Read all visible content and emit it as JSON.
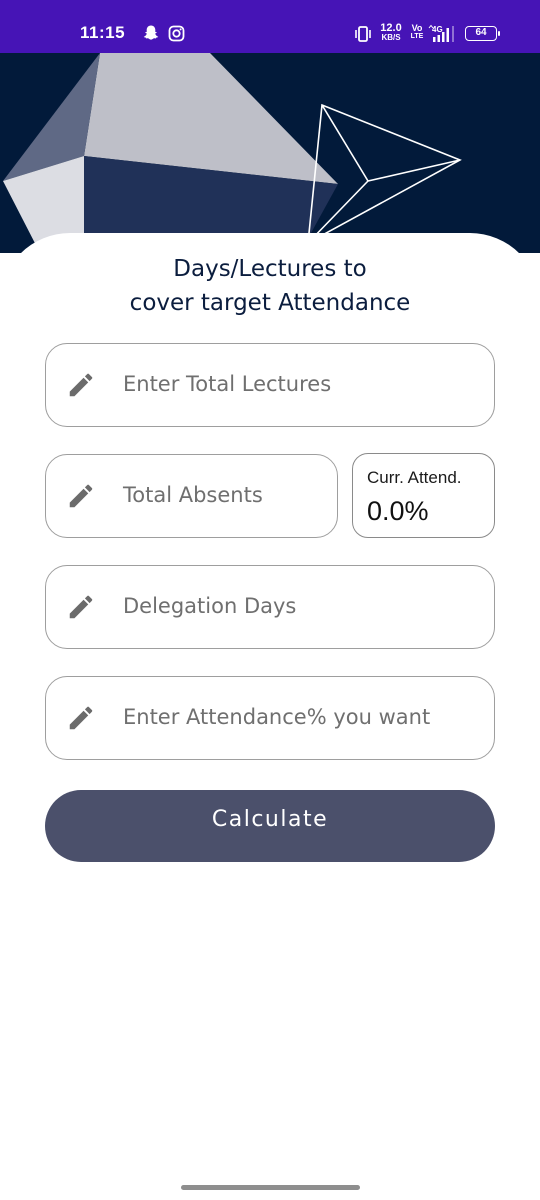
{
  "status_bar": {
    "time": "11:15",
    "speed_value": "12.0",
    "speed_unit": "KB/S",
    "volte_top": "Vo",
    "volte_bottom": "LTE",
    "network": "4G",
    "battery": "64",
    "background_color": "#4614b6"
  },
  "header": {
    "title_line1": "Days/Lectures to",
    "title_line2": "cover target Attendance"
  },
  "form": {
    "total_lectures": {
      "value": "",
      "placeholder": "Enter Total Lectures",
      "icon": "pencil-icon"
    },
    "total_absents": {
      "value": "",
      "placeholder": "Total Absents",
      "icon": "pencil-icon"
    },
    "delegation_days": {
      "value": "",
      "placeholder": "Delegation Days",
      "icon": "pencil-icon"
    },
    "target_attendance": {
      "value": "",
      "placeholder": "Enter Attendance% you want",
      "icon": "pencil-icon"
    }
  },
  "current_attendance": {
    "label": "Curr. Attend.",
    "value": "0.0%"
  },
  "actions": {
    "calculate_label": "Calculate",
    "button_color": "#4b506b"
  },
  "colors": {
    "header_background": "#021a3a",
    "title_text": "#0b1d3e"
  }
}
